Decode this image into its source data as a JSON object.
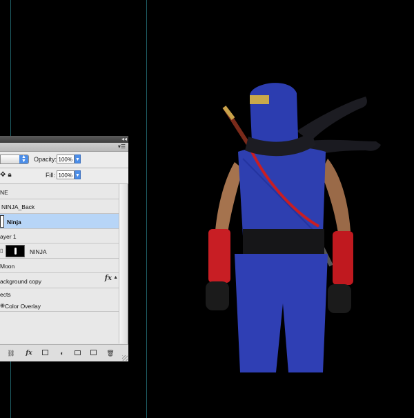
{
  "panel": {
    "blend_mode": "",
    "opacity_label": "Opacity:",
    "opacity_value": "100%",
    "fill_label": "Fill:",
    "fill_value": "100%",
    "layers": [
      {
        "name": "NE",
        "selected": false
      },
      {
        "name": "NINJA_Back",
        "selected": false
      },
      {
        "name": "Ninja",
        "selected": true
      },
      {
        "name": "ayer 1",
        "selected": false
      },
      {
        "name": "NINJA",
        "selected": false
      },
      {
        "name": "Moon",
        "selected": false
      },
      {
        "name": "ackground copy",
        "selected": false
      },
      {
        "name": "ects",
        "selected": false
      },
      {
        "name": "Color Overlay",
        "selected": false
      }
    ],
    "footer_icons": [
      "link-icon",
      "fx-icon",
      "mask-icon",
      "adjustment-icon",
      "folder-icon",
      "new-layer-icon",
      "trash-icon"
    ]
  },
  "colors": {
    "background": "#000000",
    "guide": "#1f5f66",
    "selection": "#b7d5f7",
    "ninja_blue": "#2e3fb0",
    "ninja_red": "#c81e24"
  }
}
